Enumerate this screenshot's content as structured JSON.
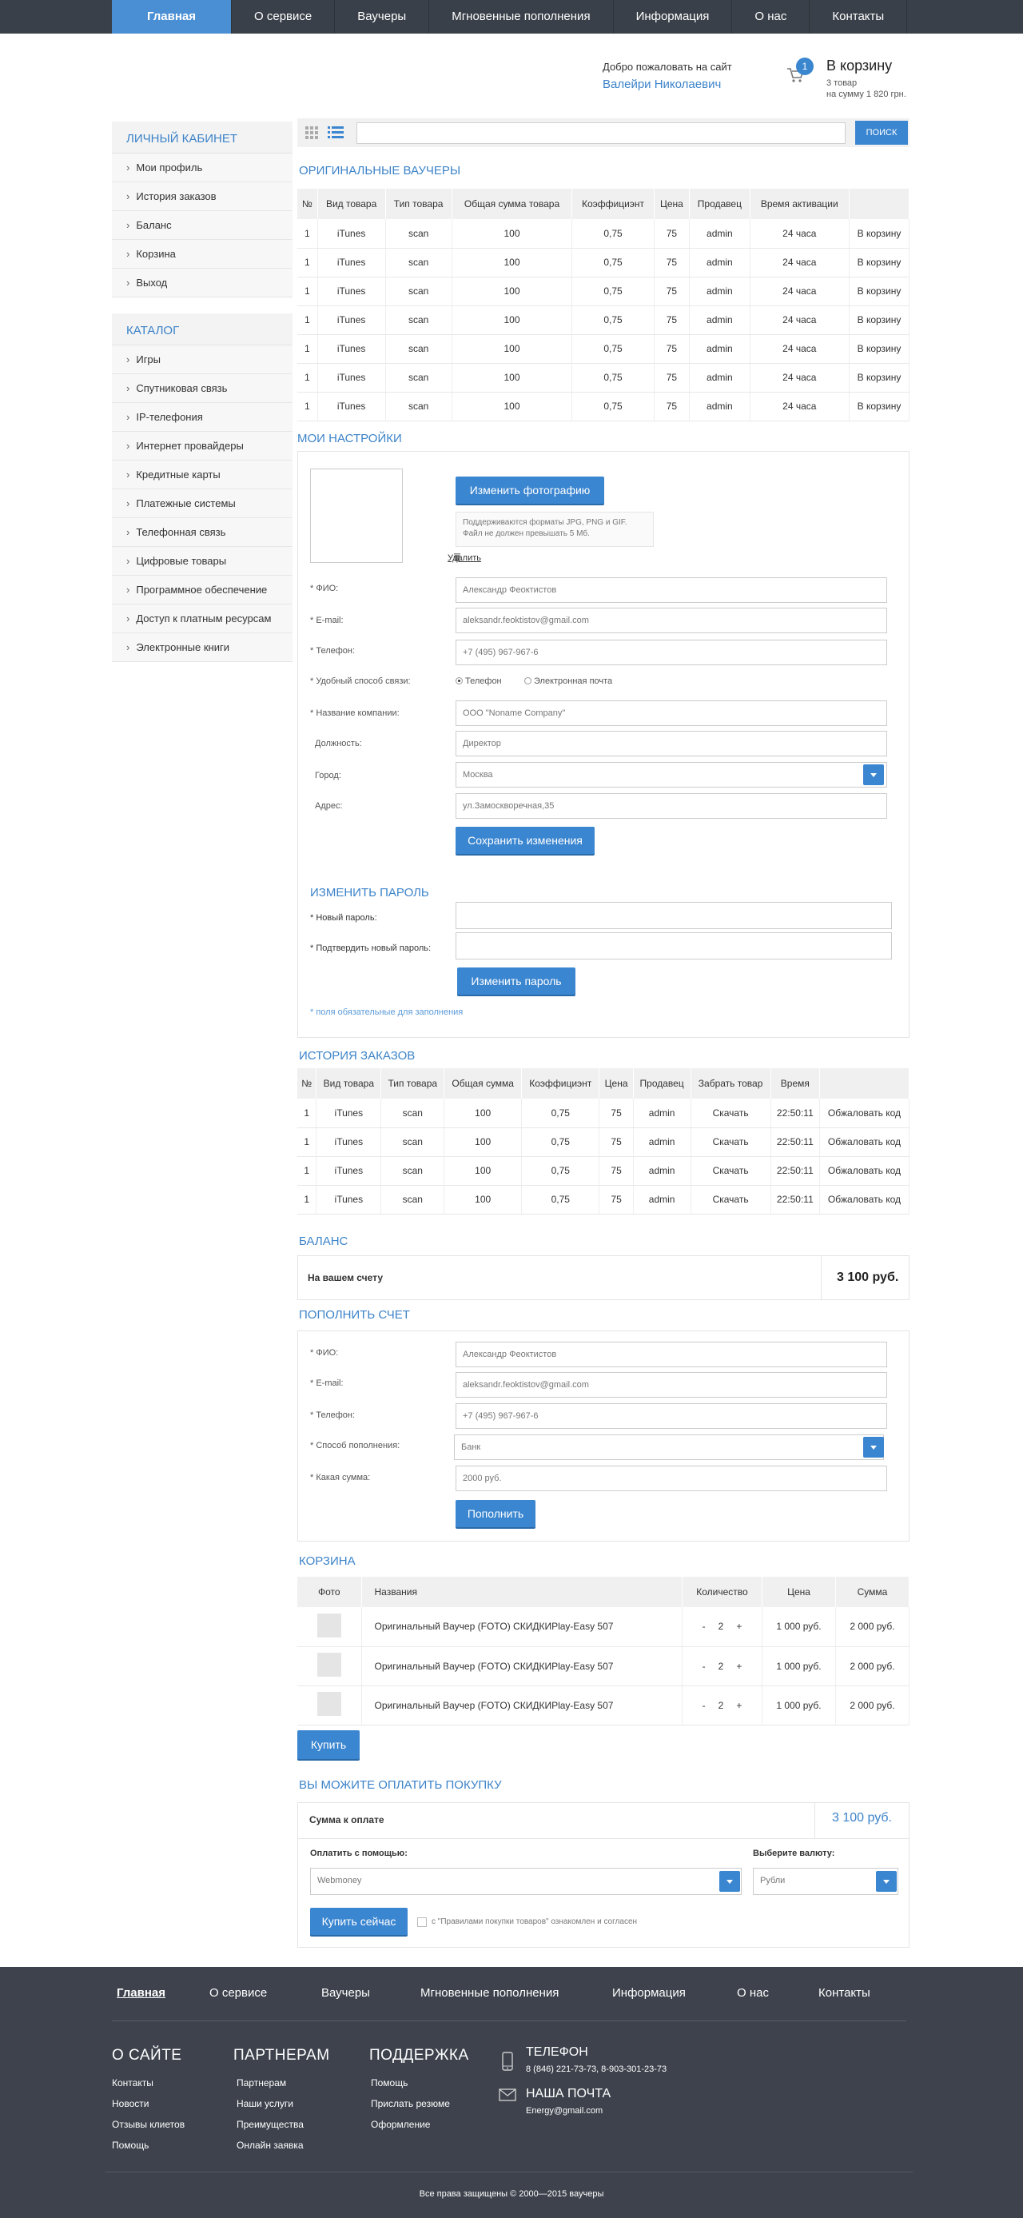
{
  "topnav": {
    "items": [
      "Главная",
      "О сервисе",
      "Ваучеры",
      "Мгновенные пополнения",
      "Информация",
      "О нас",
      "Контакты"
    ]
  },
  "header": {
    "welcome": "Добро пожаловать на сайт",
    "user_name": "Валейри Николаевич",
    "cart": {
      "count": "1",
      "title": "В корзину",
      "items": "3 товар",
      "total": "на сумму 1 820 грн."
    }
  },
  "sidebar": {
    "cabinet_title": "ЛИЧНЫЙ КАБИНЕТ",
    "cabinet": [
      "Мои профиль",
      "История заказов",
      "Баланс",
      "Корзина",
      "Выход"
    ],
    "catalog_title": "КАТАЛОГ",
    "catalog": [
      "Игры",
      "Спутниковая связь",
      "IP-телефония",
      "Интернет провайдеры",
      "Кредитные карты",
      "Платежные системы",
      "Телефонная связь",
      "Цифровые товары",
      "Программное обеспечение",
      "Доступ к платным ресурсам",
      "Электронные книги"
    ]
  },
  "search": {
    "button": "ПОИСК"
  },
  "vouchers": {
    "title": "ОРИГИНАЛЬНЫЕ ВАУЧЕРЫ",
    "headers": [
      "№",
      "Вид товара",
      "Тип товара",
      "Общая сумма товара",
      "Коэффициэнт",
      "Цена",
      "Продавец",
      "Время активации",
      ""
    ],
    "rows": [
      [
        "1",
        "iTunes",
        "scan",
        "100",
        "0,75",
        "75",
        "admin",
        "24 часа",
        "В корзину"
      ],
      [
        "1",
        "iTunes",
        "scan",
        "100",
        "0,75",
        "75",
        "admin",
        "24 часа",
        "В корзину"
      ],
      [
        "1",
        "iTunes",
        "scan",
        "100",
        "0,75",
        "75",
        "admin",
        "24 часа",
        "В корзину"
      ],
      [
        "1",
        "iTunes",
        "scan",
        "100",
        "0,75",
        "75",
        "admin",
        "24 часа",
        "В корзину"
      ],
      [
        "1",
        "iTunes",
        "scan",
        "100",
        "0,75",
        "75",
        "admin",
        "24 часа",
        "В корзину"
      ],
      [
        "1",
        "iTunes",
        "scan",
        "100",
        "0,75",
        "75",
        "admin",
        "24 часа",
        "В корзину"
      ],
      [
        "1",
        "iTunes",
        "scan",
        "100",
        "0,75",
        "75",
        "admin",
        "24 часа",
        "В корзину"
      ]
    ]
  },
  "settings": {
    "title": "МОИ НАСТРОЙКИ",
    "change_photo": "Изменить фотографию",
    "hint1": "Поддерживаются форматы JPG, PNG и GIF.",
    "hint2": "Файл не должен превышать 5 Мб.",
    "delete": "Удалить",
    "labels": {
      "fio": "* ФИО:",
      "email": "* E-mail:",
      "phone": "* Телефон:",
      "contact": "* Удобный способ связи:",
      "company": "* Название компании:",
      "position": "Должность:",
      "city": "Город:",
      "address": "Адрес:"
    },
    "values": {
      "fio": "Александр Феоктистов",
      "email": "aleksandr.feoktistov@gmail.com",
      "phone": "+7 (495) 967-967-6",
      "company": "ООО \"Noname Company\"",
      "position": "Директор",
      "city": "Москва",
      "address": "ул.Замоскворечная,35"
    },
    "radio_phone": "Телефон",
    "radio_email": "Электронная почта",
    "save": "Сохранить изменения",
    "pw_title": "ИЗМЕНИТЬ ПАРОЛЬ",
    "new_pw": "* Новый пароль:",
    "confirm_pw": "* Подтвердить новый пароль:",
    "change_pw": "Изменить пароль",
    "required_note": "* поля обязательные для заполнения"
  },
  "history": {
    "title": "ИСТОРИЯ ЗАКАЗОВ",
    "headers": [
      "№",
      "Вид товара",
      "Тип товара",
      "Общая сумма",
      "Коэффициэнт",
      "Цена",
      "Продавец",
      "Забрать товар",
      "Время",
      ""
    ],
    "rows": [
      [
        "1",
        "iTunes",
        "scan",
        "100",
        "0,75",
        "75",
        "admin",
        "Скачать",
        "22:50:11",
        "Обжаловать код"
      ],
      [
        "1",
        "iTunes",
        "scan",
        "100",
        "0,75",
        "75",
        "admin",
        "Скачать",
        "22:50:11",
        "Обжаловать код"
      ],
      [
        "1",
        "iTunes",
        "scan",
        "100",
        "0,75",
        "75",
        "admin",
        "Скачать",
        "22:50:11",
        "Обжаловать код"
      ],
      [
        "1",
        "iTunes",
        "scan",
        "100",
        "0,75",
        "75",
        "admin",
        "Скачать",
        "22:50:11",
        "Обжаловать код"
      ]
    ]
  },
  "balance": {
    "title": "БАЛАНС",
    "label": "На вашем счету",
    "value": "3 100 руб."
  },
  "topup": {
    "title": "ПОПОЛНИТЬ СЧЕТ",
    "labels": {
      "fio": "* ФИО:",
      "email": "* E-mail:",
      "phone": "* Телефон:",
      "method": "* Способ пополнения:",
      "amount": "* Какая сумма:"
    },
    "values": {
      "fio": "Александр Феоктистов",
      "email": "aleksandr.feoktistov@gmail.com",
      "phone": "+7 (495) 967-967-6",
      "method": "Банк",
      "amount": "2000 руб."
    },
    "button": "Пополнить"
  },
  "cart": {
    "title": "КОРЗИНА",
    "headers": [
      "Фото",
      "Названия",
      "Количество",
      "Цена",
      "Сумма"
    ],
    "rows": [
      {
        "name": "Оригинальный Ваучер (FOTO) СКИДКИPlay-Easy  507",
        "qty": "2",
        "price": "1 000 руб.",
        "sum": "2 000 руб."
      },
      {
        "name": "Оригинальный Ваучер (FOTO) СКИДКИPlay-Easy  507",
        "qty": "2",
        "price": "1 000 руб.",
        "sum": "2 000 руб."
      },
      {
        "name": "Оригинальный Ваучер (FOTO) СКИДКИPlay-Easy  507",
        "qty": "2",
        "price": "1 000 руб.",
        "sum": "2 000 руб."
      }
    ],
    "minus": "-",
    "plus": "+",
    "buy": "Купить"
  },
  "payment": {
    "title": "ВЫ МОЖИТЕ ОПЛАТИТЬ ПОКУПКУ",
    "sum_label": "Сумма к оплате",
    "sum_value": "3 100 руб.",
    "pay_with": "Оплатить с помощью:",
    "pay_value": "Webmoney",
    "currency_label": "Выберите валюту:",
    "currency_value": "Рубли",
    "buy_now": "Купить сейчас",
    "agree": "с \"Правилами покупки товаров\" ознакомлен и согласен"
  },
  "footer": {
    "nav": [
      "Главная",
      "О сервисе",
      "Ваучеры",
      "Мгновенные пополнения",
      "Информация",
      "О нас",
      "Контакты"
    ],
    "about_title": "О САЙТЕ",
    "about": [
      "Контакты",
      "Новости",
      "Отзывы клиетов",
      "Помощь"
    ],
    "partners_title": "ПАРТНЕРАМ",
    "partners": [
      "Партнерам",
      "Наши услуги",
      "Преимущества",
      "Онлайн заявка"
    ],
    "support_title": "ПОДДЕРЖКА",
    "support": [
      "Помощь",
      "Прислать резюме",
      "Оформление"
    ],
    "phone_title": "ТЕЛЕФОН",
    "phone": "8 (846) 221-73-73, 8-903-301-23-73",
    "mail_title": "НАША ПОЧТА",
    "mail": "Energy@gmail.com",
    "copyright": "Все права защищены   ©   2000—2015 ваучеры"
  }
}
